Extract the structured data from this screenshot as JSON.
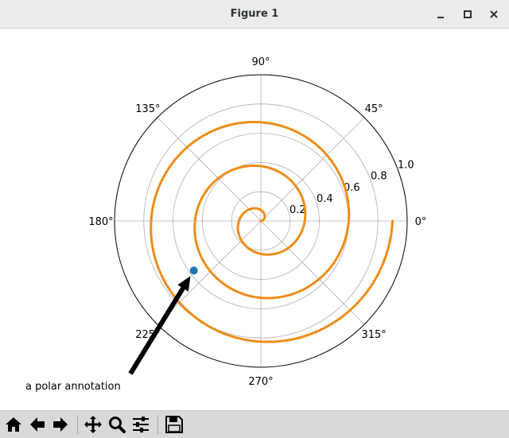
{
  "window": {
    "title": "Figure 1",
    "controls": [
      "minimize-icon",
      "maximize-icon",
      "close-icon"
    ]
  },
  "chart_data": {
    "type": "line",
    "projection": "polar",
    "series": [
      {
        "kind": "spiral",
        "theta_start_turns": 0,
        "theta_end_turns": 3,
        "r_start": 0,
        "r_end": 0.9,
        "color": "#ee8d18"
      }
    ],
    "annotation": {
      "text": "a polar annotation",
      "point_r": 0.57,
      "point_theta_deg": 216.5,
      "marker_color": "#1f77b4",
      "arrow_color": "#000000"
    },
    "theta_ticks": [
      "0°",
      "45°",
      "90°",
      "135°",
      "180°",
      "225°",
      "270°",
      "315°"
    ],
    "r_ticks": [
      "0.2",
      "0.4",
      "0.6",
      "0.8",
      "1.0"
    ],
    "r_tick_values": [
      0.2,
      0.4,
      0.6,
      0.8,
      1.0
    ],
    "rlim": [
      0,
      1.0
    ],
    "grid": true
  },
  "toolbar": {
    "buttons": [
      {
        "name": "home-button",
        "icon": "home-icon"
      },
      {
        "name": "back-button",
        "icon": "back-arrow-icon"
      },
      {
        "name": "forward-button",
        "icon": "forward-arrow-icon"
      },
      {
        "name": "pan-button",
        "icon": "move-icon"
      },
      {
        "name": "zoom-button",
        "icon": "magnifier-icon"
      },
      {
        "name": "configure-subplots-button",
        "icon": "sliders-icon"
      },
      {
        "name": "save-button",
        "icon": "floppy-icon"
      }
    ]
  }
}
